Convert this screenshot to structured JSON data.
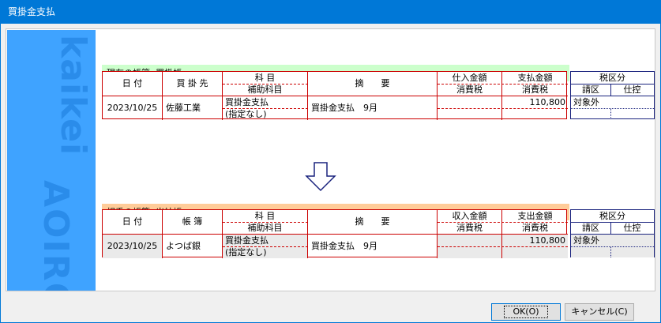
{
  "window": {
    "title": "買掛金支払"
  },
  "sidebar": {
    "brand_top": "kaikei",
    "brand_bottom": "AOIRO"
  },
  "current_book": {
    "label": "現在の帳簿: 買掛帳",
    "headers": {
      "date": "日 付",
      "partner": "買 掛 先",
      "account": "科 目",
      "sub_account": "補助科目",
      "description": "摘　　要",
      "purchase_amount": "仕入金額",
      "consumption_tax1": "消費税",
      "payment_amount": "支払金額",
      "consumption_tax2": "消費税"
    },
    "row": {
      "date": "2023/10/25",
      "partner": "佐藤工業",
      "account": "買掛金支払",
      "sub_account": "(指定なし)",
      "description": "買掛金支払　9月",
      "purchase_amount": "",
      "payment_amount": "110,800"
    },
    "tax": {
      "title": "税区分",
      "col1": "請区",
      "col2": "仕控",
      "value": "対象外"
    }
  },
  "partner_book": {
    "label": "相手の帳簿: 出納帳",
    "headers": {
      "date": "日 付",
      "book": "帳 簿",
      "account": "科 目",
      "sub_account": "補助科目",
      "description": "摘　　要",
      "receipt_amount": "収入金額",
      "consumption_tax1": "消費税",
      "payment_amount": "支出金額",
      "consumption_tax2": "消費税"
    },
    "row": {
      "date": "2023/10/25",
      "book": "よつば銀",
      "account": "買掛金支払",
      "sub_account": "(指定なし)",
      "description": "買掛金支払　9月",
      "receipt_amount": "",
      "payment_amount": "110,800"
    },
    "tax": {
      "title": "税区分",
      "col1": "請区",
      "col2": "仕控",
      "value": "対象外"
    }
  },
  "buttons": {
    "ok": "OK(O)",
    "cancel": "キャンセル(C)"
  }
}
